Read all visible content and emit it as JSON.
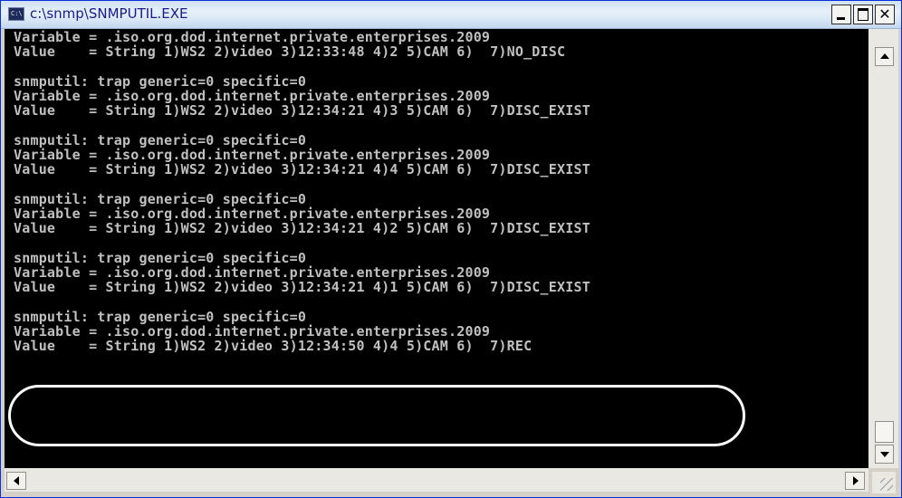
{
  "window": {
    "title": "c:\\snmp\\SNMPUTIL.EXE",
    "icon": "console-icon",
    "icon_text": "C:\\"
  },
  "console": {
    "lines": [
      "Variable = .iso.org.dod.internet.private.enterprises.2009",
      "Value    = String 1)WS2 2)video 3)12:33:48 4)2 5)CAM 6)  7)NO_DISC",
      "",
      "snmputil: trap generic=0 specific=0",
      "Variable = .iso.org.dod.internet.private.enterprises.2009",
      "Value    = String 1)WS2 2)video 3)12:34:21 4)3 5)CAM 6)  7)DISC_EXIST",
      "",
      "snmputil: trap generic=0 specific=0",
      "Variable = .iso.org.dod.internet.private.enterprises.2009",
      "Value    = String 1)WS2 2)video 3)12:34:21 4)4 5)CAM 6)  7)DISC_EXIST",
      "",
      "snmputil: trap generic=0 specific=0",
      "Variable = .iso.org.dod.internet.private.enterprises.2009",
      "Value    = String 1)WS2 2)video 3)12:34:21 4)2 5)CAM 6)  7)DISC_EXIST",
      "",
      "snmputil: trap generic=0 specific=0",
      "Variable = .iso.org.dod.internet.private.enterprises.2009",
      "Value    = String 1)WS2 2)video 3)12:34:21 4)1 5)CAM 6)  7)DISC_EXIST",
      "",
      "snmputil: trap generic=0 specific=0",
      "Variable = .iso.org.dod.internet.private.enterprises.2009",
      "Value    = String 1)WS2 2)video 3)12:34:50 4)4 5)CAM 6)  7)REC"
    ]
  },
  "colors": {
    "console_bg": "#000000",
    "console_text": "#c0c0c0",
    "highlight": "#ffffff"
  }
}
